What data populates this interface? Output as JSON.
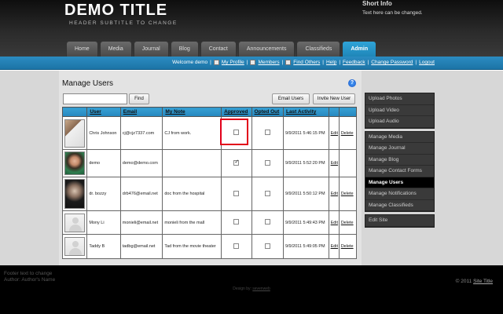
{
  "header": {
    "title": "DEMO TITLE",
    "subtitle": "HEADER SUBTITLE TO CHANGE",
    "short_info_title": "Short Info",
    "short_info_text": "Text here can be changed."
  },
  "tabs": [
    {
      "label": "Home"
    },
    {
      "label": "Media"
    },
    {
      "label": "Journal"
    },
    {
      "label": "Blog"
    },
    {
      "label": "Contact"
    },
    {
      "label": "Announcements"
    },
    {
      "label": "Classifieds"
    },
    {
      "label": "Admin",
      "active": true
    }
  ],
  "userbar": {
    "welcome": "Welcome demo",
    "links": [
      "My Profile",
      "Members",
      "Find Others",
      "Help",
      "Feedback",
      "Change Password",
      "Logout"
    ]
  },
  "main": {
    "title": "Manage Users",
    "search_value": "",
    "find_label": "Find",
    "email_users_label": "Email Users",
    "invite_label": "Invite New User"
  },
  "table": {
    "headers": [
      "User",
      "Email",
      "My Note",
      "Approved",
      "Opted Out",
      "Last Activity"
    ],
    "rows": [
      {
        "name": "Chris Johnson",
        "email": "cj@cjz7337.com",
        "note": "CJ from work.",
        "approved": false,
        "opted_out": false,
        "last_activity": "9/9/2011 5:46:15 PM",
        "edit": "Edit",
        "delete": "Delete"
      },
      {
        "name": "demo",
        "email": "demo@demo.com",
        "note": "",
        "approved": true,
        "opted_out": false,
        "last_activity": "9/9/2011 5:52:20 PM",
        "edit": "Edit",
        "delete": ""
      },
      {
        "name": "dr. bozzy",
        "email": "drb476@email.net",
        "note": "doc from the hospital",
        "approved": false,
        "opted_out": false,
        "last_activity": "9/9/2011 5:50:12 PM",
        "edit": "Edit",
        "delete": "Delete"
      },
      {
        "name": "Mony Li",
        "email": "monieli@email.net",
        "note": "monieli from the mall",
        "approved": false,
        "opted_out": false,
        "last_activity": "9/9/2011 5:49:43 PM",
        "edit": "Edit",
        "delete": "Delete"
      },
      {
        "name": "Taddy B",
        "email": "tadbg@email.net",
        "note": "Tad from the movie theater",
        "approved": false,
        "opted_out": false,
        "last_activity": "9/9/2011 5:49:05 PM",
        "edit": "Edit",
        "delete": "Delete"
      }
    ]
  },
  "sidebar": {
    "group1": [
      "Upload Photos",
      "Upload Video",
      "Upload Audio"
    ],
    "group2": [
      "Manage Media",
      "Manage Journal",
      "Manage Blog",
      "Manage Contact Forms",
      "Manage Users",
      "Manage Notifications",
      "Manage Classifieds"
    ],
    "active": "Manage Users",
    "group3": [
      "Edit Site"
    ]
  },
  "footer": {
    "line1": "Footer text to change",
    "line2": "Author: Author's Name",
    "credit_prefix": "Design by:",
    "credit_link": "sevenweb",
    "copyright": "© 2011",
    "site_link": "Site Title"
  },
  "colors": {
    "accent": "#2588bf",
    "highlight": "#e2001a"
  }
}
